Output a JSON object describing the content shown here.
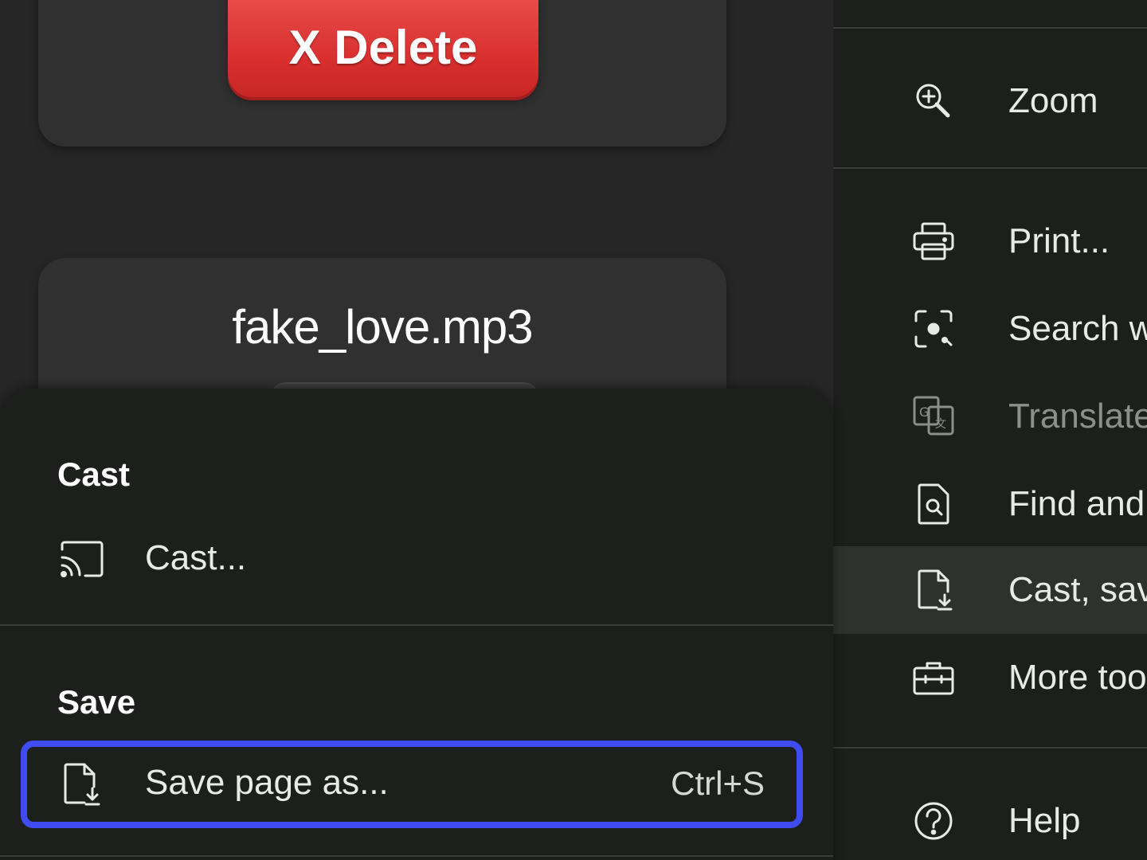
{
  "background": {
    "delete_button_label": "X Delete",
    "file_name": "fake_love.mp3"
  },
  "main_menu": {
    "items": [
      {
        "label": "Zoom",
        "icon": "zoom-icon"
      },
      {
        "label": "Print...",
        "icon": "print-icon"
      },
      {
        "label": "Search w",
        "icon": "lens-search-icon"
      },
      {
        "label": "Translate",
        "icon": "translate-icon",
        "disabled": true
      },
      {
        "label": "Find and",
        "icon": "find-page-icon"
      },
      {
        "label": "Cast, sav",
        "icon": "cast-save-icon",
        "active": true
      },
      {
        "label": "More too",
        "icon": "toolbox-icon"
      },
      {
        "label": "Help",
        "icon": "help-icon"
      }
    ]
  },
  "submenu": {
    "cast_heading": "Cast",
    "cast_item": {
      "label": "Cast...",
      "icon": "cast-icon"
    },
    "save_heading": "Save",
    "save_item": {
      "label": "Save page as...",
      "shortcut": "Ctrl+S",
      "icon": "save-page-icon"
    }
  },
  "colors": {
    "highlight_border": "#3f4cf2",
    "delete_button": "#e03a3a",
    "menu_background": "#1c1f1c"
  }
}
